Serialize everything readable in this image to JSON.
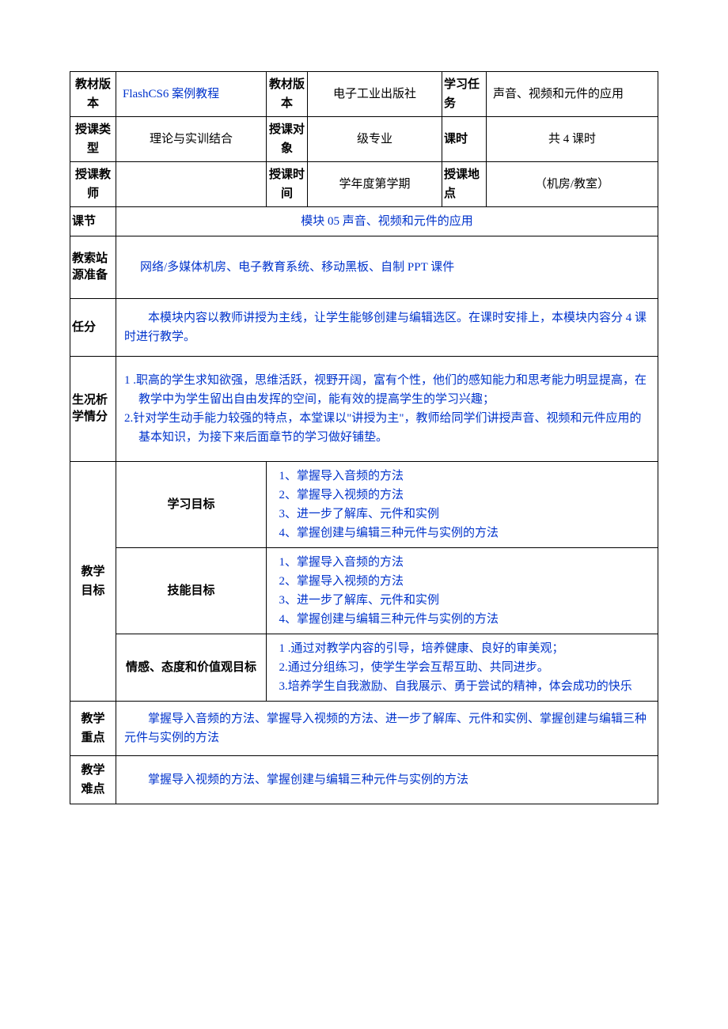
{
  "row1": {
    "c1_label": "教材版本",
    "c1_value": "FlashCS6 案例教程",
    "c2_label": "教材版本",
    "c2_value": "电子工业出版社",
    "c3_label": "学习任务",
    "c3_value": "声音、视频和元件的应用"
  },
  "row2": {
    "c1_label": "授课类型",
    "c1_value": "理论与实训结合",
    "c2_label": "授课对象",
    "c2_value": "级专业",
    "c3_label": "课时",
    "c3_value": "共 4 课时"
  },
  "row3": {
    "c1_label": "授课教师",
    "c1_value": "",
    "c2_label": "授课时间",
    "c2_value": "学年度第学期",
    "c3_label": "授课地点",
    "c3_value": "（机房/教室）"
  },
  "section": {
    "label": "课节",
    "value": "模块 05 声音、视频和元件的应用"
  },
  "resources": {
    "label": "教索站源准备",
    "value": "网络/多媒体机房、电子教育系统、移动黑板、自制 PPT 课件"
  },
  "task": {
    "label": "任分",
    "value": "本模块内容以教师讲授为主线，让学生能够创建与编辑选区。在课时安排上，本模块内容分 4 课时进行教学。"
  },
  "situation": {
    "label": "生况析学情分",
    "item1": "1   .职高的学生求知欲强，思维活跃，视野开阔，富有个性，他们的感知能力和思考能力明显提高，在教学中为学生留出自由发挥的空间，能有效的提高学生的学习兴趣；",
    "item2": "2.针对学生动手能力较强的特点，本堂课以\"讲授为主\"，教师给同学们讲授声音、视频和元件应用的基本知识，为接下来后面章节的学习做好铺垫。"
  },
  "goals": {
    "label": "教学目标",
    "g1": {
      "title": "学习目标",
      "l1": "1、掌握导入音频的方法",
      "l2": "2、掌握导入视频的方法",
      "l3": "3、进一步了解库、元件和实例",
      "l4": "4、掌握创建与编辑三种元件与实例的方法"
    },
    "g2": {
      "title": "技能目标",
      "l1": "1、掌握导入音频的方法",
      "l2": "2、掌握导入视频的方法",
      "l3": "3、进一步了解库、元件和实例",
      "l4": "4、掌握创建与编辑三种元件与实例的方法"
    },
    "g3": {
      "title": "情感、态度和价值观目标",
      "l1": "1           .通过对教学内容的引导，培养健康、良好的审美观；",
      "l2": "2.通过分组练习，使学生学会互帮互助、共同进步。",
      "l3": "3.培养学生自我激励、自我展示、勇于尝试的精神，体会成功的快乐"
    }
  },
  "keypoint": {
    "label": "教学重点",
    "value": "掌握导入音频的方法、掌握导入视频的方法、进一步了解库、元件和实例、掌握创建与编辑三种元件与实例的方法"
  },
  "difficulty": {
    "label": "教学难点",
    "value": "掌握导入视频的方法、掌握创建与编辑三种元件与实例的方法"
  }
}
